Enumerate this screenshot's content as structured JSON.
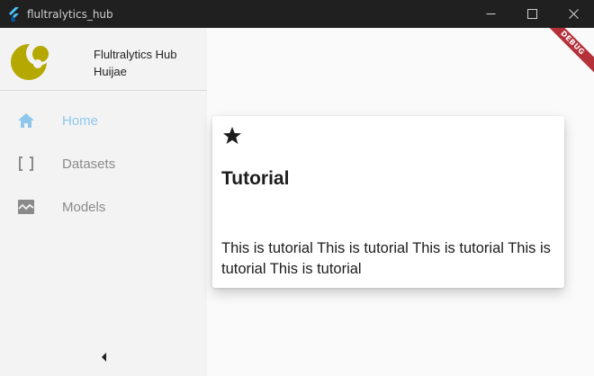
{
  "window": {
    "title": "flultralytics_hub",
    "controls": [
      "minimize-icon",
      "maximize-icon",
      "close-icon"
    ]
  },
  "sidebar": {
    "app_name": "Flultralytics Hub",
    "user_name": "Huijae",
    "items": [
      {
        "label": "Home",
        "icon": "home-icon",
        "active": true
      },
      {
        "label": "Datasets",
        "icon": "brackets-icon",
        "active": false
      },
      {
        "label": "Models",
        "icon": "image-chart-icon",
        "active": false
      }
    ],
    "collapse_icon": "chevron-left-icon"
  },
  "card": {
    "icon": "star-icon",
    "title": "Tutorial",
    "body": "This is tutorial This is tutorial This is tutorial This is tutorial This is tutorial"
  },
  "debug_banner": "DEBUG",
  "colors": {
    "titlebar": "#202020",
    "sidebar_bg": "#f3f3f3",
    "active_nav": "#8fc7ec",
    "inactive_nav": "#8a8a8a",
    "logo": "#b5a800",
    "debug_ribbon": "#b5313a"
  }
}
